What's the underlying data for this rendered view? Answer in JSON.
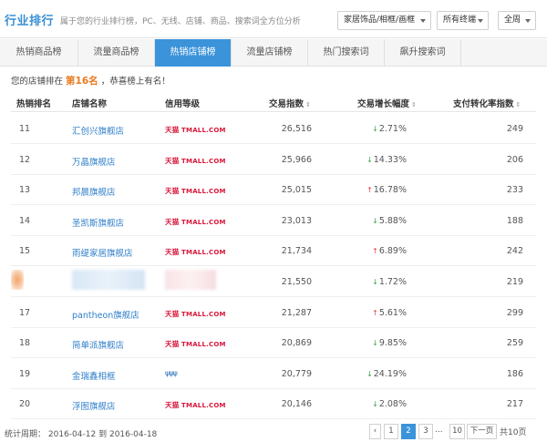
{
  "header": {
    "logo": "行业排行",
    "subtitle": "属于您的行业排行榜，PC、无线、店铺、商品、搜索词全方位分析",
    "category_select": "家居饰品/相框/画框",
    "terminal_select": "所有终端",
    "period_select": "全周"
  },
  "tabs": [
    {
      "label": "热销商品榜"
    },
    {
      "label": "流量商品榜"
    },
    {
      "label": "热销店铺榜"
    },
    {
      "label": "流量店铺榜"
    },
    {
      "label": "热门搜索词"
    },
    {
      "label": "飙升搜索词"
    }
  ],
  "notice": {
    "prefix": "您的店铺排在",
    "rank": "第16名",
    "suffix": "，恭喜榜上有名！"
  },
  "table": {
    "headers": {
      "rank": "热销排名",
      "shop": "店铺名称",
      "credit": "信用等级",
      "trade_index": "交易指数",
      "growth": "交易增长幅度",
      "conversion": "支付转化率指数"
    },
    "sort_icon": "⇕",
    "tmall_logo": {
      "cn": "天猫",
      "en": "TMALL.COM"
    },
    "crown_glyphs": "ψψψ",
    "rows": [
      {
        "rank": "11",
        "shop": "汇创兴旗舰店",
        "credit": "tmall",
        "trade": "26,516",
        "dir": "down",
        "growth": "2.71%",
        "conv": "249"
      },
      {
        "rank": "12",
        "shop": "万晶旗舰店",
        "credit": "tmall",
        "trade": "25,966",
        "dir": "down",
        "growth": "14.33%",
        "conv": "206"
      },
      {
        "rank": "13",
        "shop": "邦晨旗舰店",
        "credit": "tmall",
        "trade": "25,015",
        "dir": "up",
        "growth": "16.78%",
        "conv": "233"
      },
      {
        "rank": "14",
        "shop": "圣凯斯旗舰店",
        "credit": "tmall",
        "trade": "23,013",
        "dir": "down",
        "growth": "5.88%",
        "conv": "188"
      },
      {
        "rank": "15",
        "shop": "雨缇家居旗舰店",
        "credit": "tmall",
        "trade": "21,734",
        "dir": "up",
        "growth": "6.89%",
        "conv": "242"
      },
      {
        "rank": "",
        "shop": "",
        "credit": "blurred",
        "trade": "21,550",
        "dir": "down",
        "growth": "1.72%",
        "conv": "219"
      },
      {
        "rank": "17",
        "shop": "pantheon旗舰店",
        "credit": "tmall",
        "trade": "21,287",
        "dir": "up",
        "growth": "5.61%",
        "conv": "299"
      },
      {
        "rank": "18",
        "shop": "简单派旗舰店",
        "credit": "tmall",
        "trade": "20,869",
        "dir": "down",
        "growth": "9.85%",
        "conv": "259"
      },
      {
        "rank": "19",
        "shop": "金瑞鑫相框",
        "credit": "crown",
        "trade": "20,779",
        "dir": "down",
        "growth": "24.19%",
        "conv": "186"
      },
      {
        "rank": "20",
        "shop": "浮图旗舰店",
        "credit": "tmall",
        "trade": "20,146",
        "dir": "down",
        "growth": "2.08%",
        "conv": "217"
      }
    ]
  },
  "footer": {
    "period_label": "统计周期：",
    "date_from": "2016-04-12",
    "date_sep": "到",
    "date_to": "2016-04-18"
  },
  "pager": {
    "prev": "‹",
    "pages": [
      "1",
      "2",
      "3"
    ],
    "current": "2",
    "ellipsis": "...",
    "last_page": "10",
    "next": "下一页",
    "total": "共10页"
  },
  "colors": {
    "accent": "#3b93da",
    "link": "#2f7fc9",
    "rank_highlight": "#e87a1f",
    "up": "#e84040",
    "down": "#3aa64c",
    "tmall": "#d8173a"
  }
}
